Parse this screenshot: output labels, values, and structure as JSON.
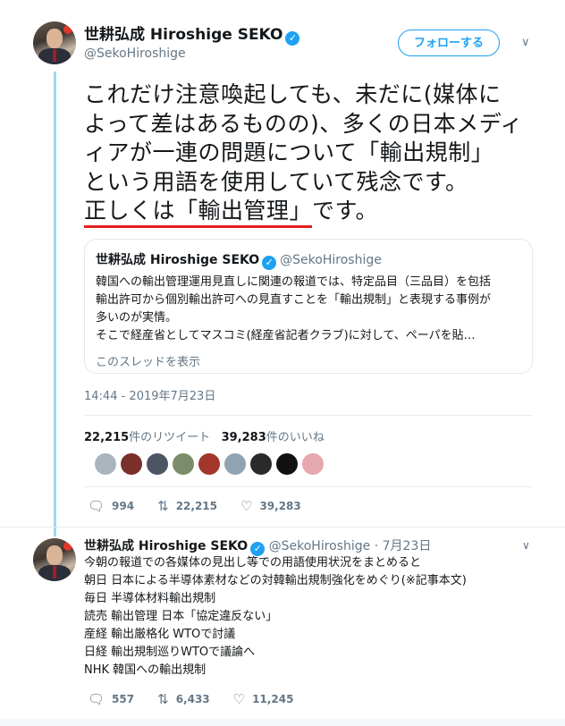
{
  "tweet": {
    "author_name": "世耕弘成 Hiroshige SEKO",
    "author_handle": "@SekoHiroshige",
    "follow_label": "フォローする",
    "text_lines": [
      "これだけ注意喚起しても、未だに(媒体に",
      "よって差はあるものの)、多くの日本メディ",
      "ィアが一連の問題について「輸出規制」",
      "という用語を使用していて残念です。"
    ],
    "text_last_highlight": "正しくは「輸出管理」",
    "text_last_rest": "です。",
    "timestamp": "14:44 - 2019年7月23日",
    "retweet_count": "22,215",
    "retweet_label": "件のリツイート",
    "like_count": "39,283",
    "like_label": "件のいいね",
    "actions": {
      "reply": "994",
      "retweet": "22,215",
      "like": "39,283"
    }
  },
  "quote": {
    "author_name": "世耕弘成 Hiroshige SEKO",
    "author_handle": "@SekoHiroshige",
    "lines": [
      "韓国への輸出管理運用見直しに関連の報道では、特定品目（三品目）を包括",
      "輸出許可から個別輸出許可への見直すことを「輸出規制」と表現する事例が",
      "多いのが実情。",
      "そこで経産省としてマスコミ(経産省記者クラブ)に対して、ペーパを貼…"
    ],
    "thread_link": "このスレッドを表示"
  },
  "likers": [
    {
      "name": "liker-avatar-1",
      "color": "#a9b4bd"
    },
    {
      "name": "liker-avatar-2",
      "color": "#7a2f2a"
    },
    {
      "name": "liker-avatar-3",
      "color": "#4b5563"
    },
    {
      "name": "liker-avatar-4",
      "color": "#7c8c6a"
    },
    {
      "name": "liker-avatar-5",
      "color": "#a3362d"
    },
    {
      "name": "liker-avatar-6",
      "color": "#8fa3b3"
    },
    {
      "name": "liker-avatar-7",
      "color": "#2a2a2a"
    },
    {
      "name": "liker-avatar-8",
      "color": "#111111"
    },
    {
      "name": "liker-avatar-9",
      "color": "#e6a8ae"
    }
  ],
  "reply": {
    "author_name": "世耕弘成 Hiroshige SEKO",
    "author_handle": "@SekoHiroshige",
    "date": "· 7月23日",
    "lines": [
      "今朝の報道での各媒体の見出し等での用語使用状況をまとめると",
      "朝日 日本による半導体素材などの対韓輸出規制強化をめぐり(※記事本文)",
      "毎日 半導体材料輸出規制",
      "読売 輸出管理 日本「協定違反ない」",
      "産経 輸出厳格化 WTOで討議",
      "日経 輸出規制巡りWTOで議論へ",
      "NHK 韓国への輸出規制"
    ],
    "actions": {
      "reply": "557",
      "retweet": "6,433",
      "like": "11,245"
    }
  },
  "colors": {
    "accent": "#1da1f2",
    "underline": "#e32020",
    "thread": "#9fd7f5"
  }
}
